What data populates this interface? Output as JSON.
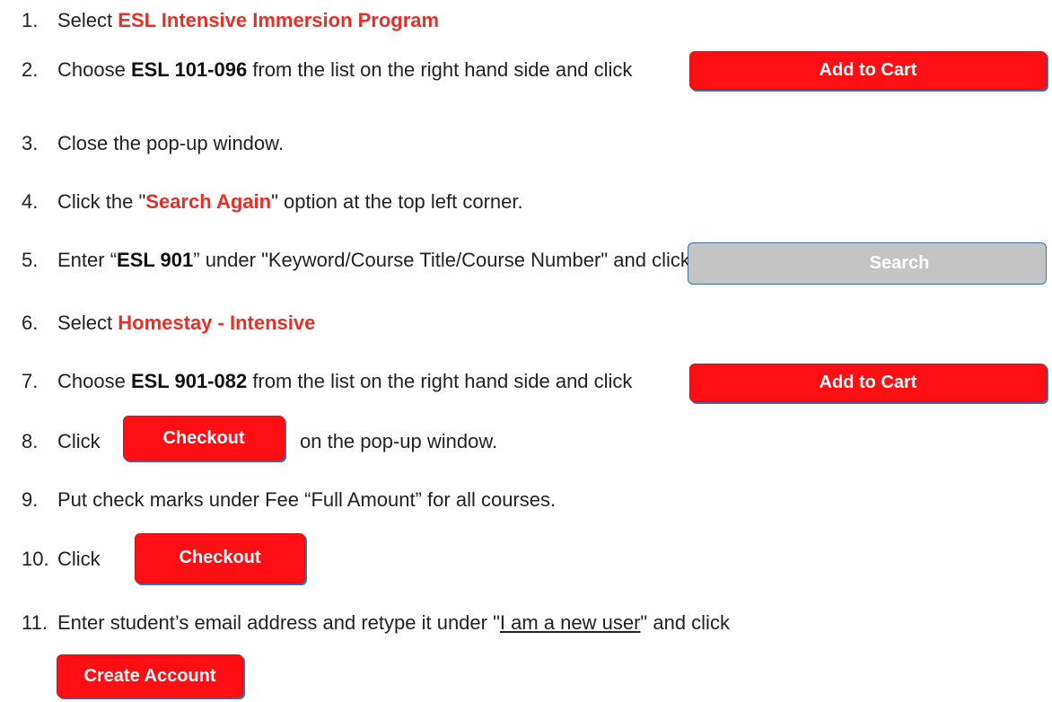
{
  "steps": [
    {
      "num": "1.",
      "parts": [
        "Select ",
        "ESL Intensive Immersion Program"
      ]
    },
    {
      "num": "2.",
      "parts": [
        "Choose ",
        "ESL 101-096",
        " from the list on the right hand side and click"
      ],
      "button": "Add to Cart"
    },
    {
      "num": "3.",
      "parts": [
        "Close the pop-up window."
      ]
    },
    {
      "num": "4.",
      "parts": [
        "Click the \"",
        "Search Again",
        "\" option at the top left corner."
      ]
    },
    {
      "num": "5.",
      "parts": [
        "Enter “",
        "ESL 901",
        "” under \"Keyword/Course Title/Course Number\" and click"
      ],
      "button": "Search"
    },
    {
      "num": "6.",
      "parts": [
        "Select ",
        "Homestay - Intensive"
      ]
    },
    {
      "num": "7.",
      "parts": [
        "Choose ",
        "ESL 901-082",
        " from the list on the right hand side and click"
      ],
      "button": "Add to Cart"
    },
    {
      "num": "8.",
      "parts": [
        "Click",
        "on the pop-up window."
      ],
      "button": "Checkout"
    },
    {
      "num": "9.",
      "parts": [
        "Put check marks under Fee “Full Amount” for all courses."
      ]
    },
    {
      "num": "10.",
      "parts": [
        "Click"
      ],
      "button": "Checkout"
    },
    {
      "num": "11.",
      "parts": [
        "Enter student’s email address and retype it under \"",
        "I am a new user",
        "\" and click"
      ],
      "button": "Create Account"
    }
  ],
  "colors": {
    "accent": "#e63027",
    "button_red": "#ff0f14",
    "button_gray": "#c4c4c4",
    "button_border": "#3c70a6"
  }
}
